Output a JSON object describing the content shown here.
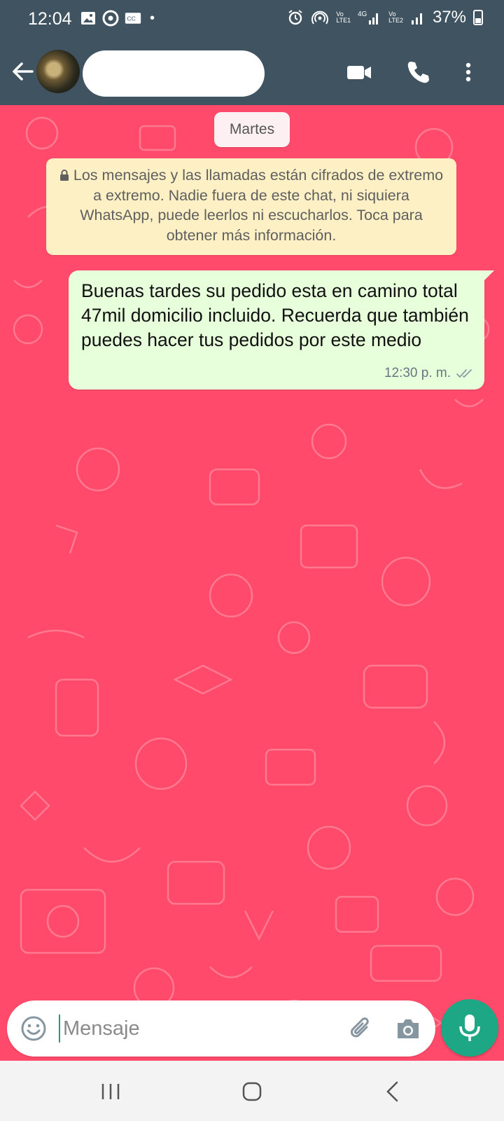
{
  "status_bar": {
    "time": "12:04",
    "battery": "37%",
    "sim1_label": "Vo\nLTE1",
    "sim1_net": "4G",
    "sim2_label": "Vo\nLTE2",
    "left_icons": [
      "gallery-icon",
      "chrome-icon",
      "cast-icon"
    ],
    "right_icons": [
      "alarm-icon",
      "hotspot-icon",
      "signal-icon",
      "battery-icon"
    ]
  },
  "app_bar": {
    "contact_name": "",
    "actions": [
      "video-call-icon",
      "voice-call-icon",
      "more-vert-icon"
    ]
  },
  "chat": {
    "date_chip": "Martes",
    "encryption_notice": "Los mensajes y las llamadas están cifrados de extremo a extremo. Nadie fuera de este chat, ni siquiera WhatsApp, puede leerlos ni escucharlos. Toca para obtener más información.",
    "messages": [
      {
        "direction": "outgoing",
        "text": "Buenas tardes su pedido esta en camino total 47mil domicilio incluido. Recuerda que también puedes hacer  tus pedidos por este medio",
        "time": "12:30 p. m.",
        "status": "delivered"
      }
    ],
    "background_color": "#ff4a6b",
    "bubble_color": "#e7ffdb",
    "notice_color": "#fdf0c4"
  },
  "composer": {
    "placeholder": "Mensaje",
    "value": "",
    "icons": [
      "emoji-icon",
      "attach-icon",
      "camera-icon",
      "mic-icon"
    ],
    "accent": "#1ea784"
  },
  "navigation": {
    "buttons": [
      "recents-icon",
      "home-icon",
      "back-icon"
    ]
  }
}
